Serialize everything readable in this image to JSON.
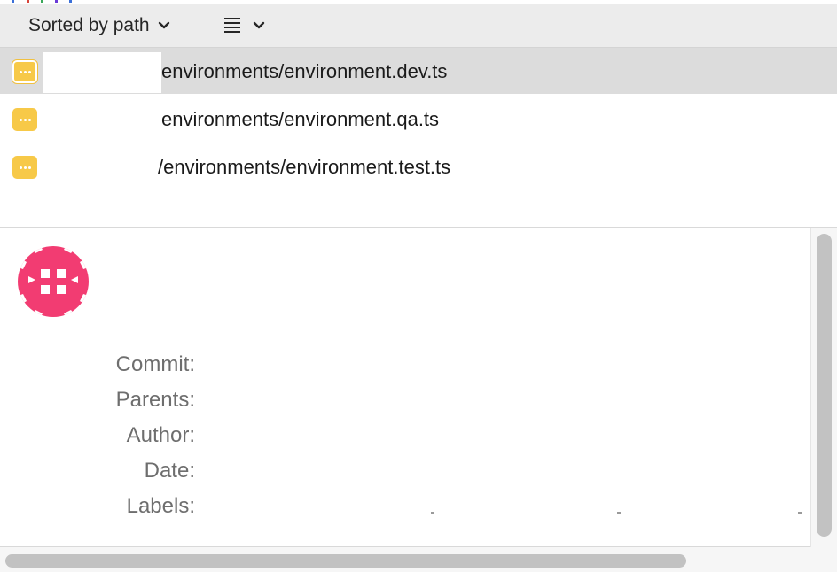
{
  "toolbar": {
    "sort_label": "Sorted by path",
    "view_icon": "list-icon",
    "sort_chevron_icon": "chevron-down-icon",
    "view_chevron_icon": "chevron-down-icon"
  },
  "files": [
    {
      "status_icon": "modified-badge-icon",
      "path": "environments/environment.dev.ts",
      "selected": true
    },
    {
      "status_icon": "modified-badge-icon",
      "path": "environments/environment.qa.ts",
      "selected": false
    },
    {
      "status_icon": "modified-badge-icon",
      "path": "/environments/environment.test.ts",
      "selected": false
    }
  ],
  "details": {
    "avatar_icon": "identicon-avatar",
    "labels": {
      "commit": "Commit:",
      "parents": "Parents:",
      "author": "Author:",
      "date": "Date:",
      "labels": "Labels:"
    }
  },
  "colors": {
    "toolbar_bg": "#ececec",
    "selected_row_bg": "#dcdcdc",
    "badge": "#f7c948",
    "avatar": "#f23c72",
    "label_text": "#6e6e6e"
  }
}
